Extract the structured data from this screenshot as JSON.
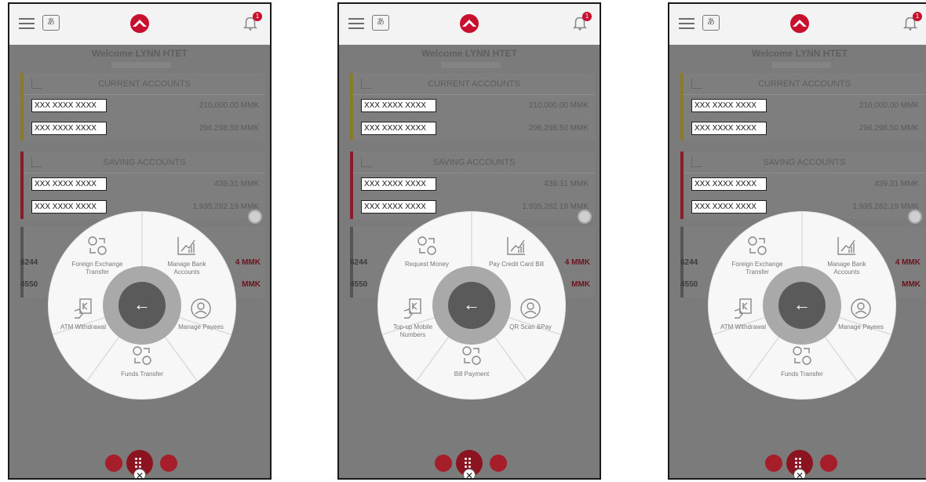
{
  "header": {
    "notification_count": "1"
  },
  "welcome": "Welcome LYNN HTET",
  "current": {
    "title": "CURRENT ACCOUNTS",
    "accounts": [
      {
        "number": "XXX XXXX XXXX",
        "balance": "210,000.00 MMK"
      },
      {
        "number": "XXX XXXX XXXX",
        "balance": "296,298.50 MMK"
      }
    ]
  },
  "saving": {
    "title": "SAVING ACCOUNTS",
    "accounts": [
      {
        "number": "XXX XXXX XXXX",
        "balance": "439.31 MMK"
      },
      {
        "number": "XXX XXXX XXXX",
        "balance": "1,935,282.19 MMK"
      }
    ]
  },
  "other": {
    "row1_prefix": "6244",
    "row2_prefix": "4550",
    "row_suffix": "4 MMK",
    "row2_suffix": "MMK"
  },
  "screens": [
    {
      "segments": {
        "top_left": "Foreign Exchange Transfer",
        "top_right": "Manage Bank Accounts",
        "left": "ATM Withdrawal",
        "right": "Manage Payees",
        "bottom": "Funds Transfer"
      }
    },
    {
      "segments": {
        "top_left": "Request Money",
        "top_right": "Pay Credit Card Bill",
        "left": "Top-up Mobile Numbers",
        "right": "QR Scan &Pay",
        "bottom": "Bill Payment"
      }
    },
    {
      "segments": {
        "top_left": "Foreign Exchange Transfer",
        "top_right": "Manage Bank Accounts",
        "left": "ATM Withdrawal",
        "right": "Manage Payees",
        "bottom": "Funds Transfer"
      }
    }
  ],
  "colors": {
    "brand": "#8c1420",
    "overlay": "#7b7b7b",
    "wheel": "#f7f7f7"
  }
}
